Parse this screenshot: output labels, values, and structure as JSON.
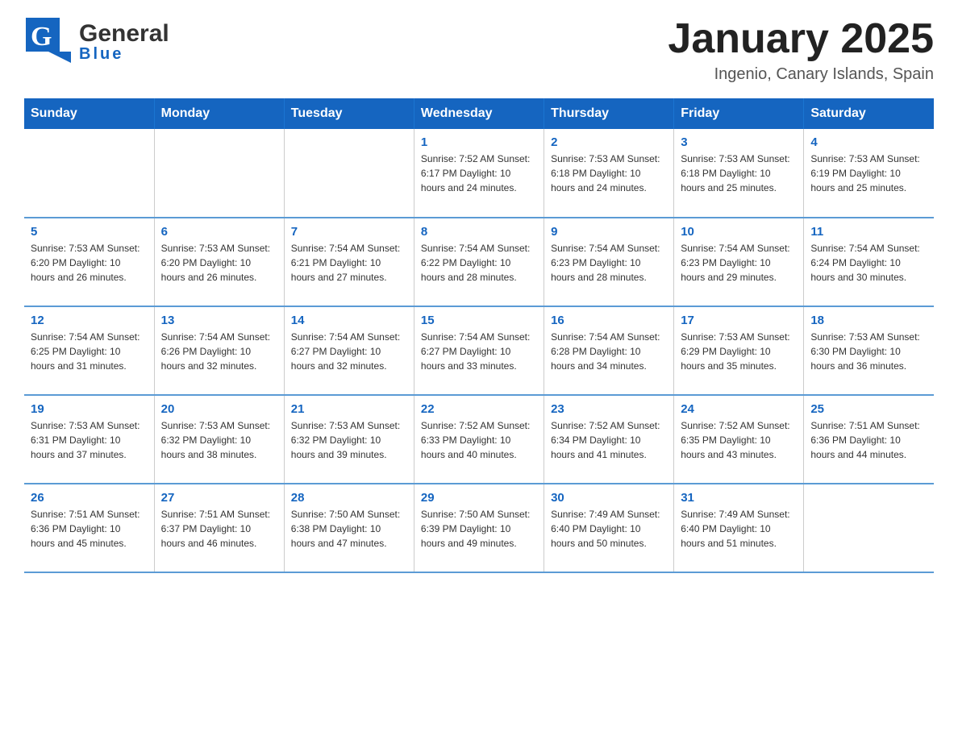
{
  "header": {
    "title": "January 2025",
    "subtitle": "Ingenio, Canary Islands, Spain",
    "logo_general": "General",
    "logo_blue": "Blue"
  },
  "columns": [
    "Sunday",
    "Monday",
    "Tuesday",
    "Wednesday",
    "Thursday",
    "Friday",
    "Saturday"
  ],
  "weeks": [
    [
      {
        "day": "",
        "info": ""
      },
      {
        "day": "",
        "info": ""
      },
      {
        "day": "",
        "info": ""
      },
      {
        "day": "1",
        "info": "Sunrise: 7:52 AM\nSunset: 6:17 PM\nDaylight: 10 hours\nand 24 minutes."
      },
      {
        "day": "2",
        "info": "Sunrise: 7:53 AM\nSunset: 6:18 PM\nDaylight: 10 hours\nand 24 minutes."
      },
      {
        "day": "3",
        "info": "Sunrise: 7:53 AM\nSunset: 6:18 PM\nDaylight: 10 hours\nand 25 minutes."
      },
      {
        "day": "4",
        "info": "Sunrise: 7:53 AM\nSunset: 6:19 PM\nDaylight: 10 hours\nand 25 minutes."
      }
    ],
    [
      {
        "day": "5",
        "info": "Sunrise: 7:53 AM\nSunset: 6:20 PM\nDaylight: 10 hours\nand 26 minutes."
      },
      {
        "day": "6",
        "info": "Sunrise: 7:53 AM\nSunset: 6:20 PM\nDaylight: 10 hours\nand 26 minutes."
      },
      {
        "day": "7",
        "info": "Sunrise: 7:54 AM\nSunset: 6:21 PM\nDaylight: 10 hours\nand 27 minutes."
      },
      {
        "day": "8",
        "info": "Sunrise: 7:54 AM\nSunset: 6:22 PM\nDaylight: 10 hours\nand 28 minutes."
      },
      {
        "day": "9",
        "info": "Sunrise: 7:54 AM\nSunset: 6:23 PM\nDaylight: 10 hours\nand 28 minutes."
      },
      {
        "day": "10",
        "info": "Sunrise: 7:54 AM\nSunset: 6:23 PM\nDaylight: 10 hours\nand 29 minutes."
      },
      {
        "day": "11",
        "info": "Sunrise: 7:54 AM\nSunset: 6:24 PM\nDaylight: 10 hours\nand 30 minutes."
      }
    ],
    [
      {
        "day": "12",
        "info": "Sunrise: 7:54 AM\nSunset: 6:25 PM\nDaylight: 10 hours\nand 31 minutes."
      },
      {
        "day": "13",
        "info": "Sunrise: 7:54 AM\nSunset: 6:26 PM\nDaylight: 10 hours\nand 32 minutes."
      },
      {
        "day": "14",
        "info": "Sunrise: 7:54 AM\nSunset: 6:27 PM\nDaylight: 10 hours\nand 32 minutes."
      },
      {
        "day": "15",
        "info": "Sunrise: 7:54 AM\nSunset: 6:27 PM\nDaylight: 10 hours\nand 33 minutes."
      },
      {
        "day": "16",
        "info": "Sunrise: 7:54 AM\nSunset: 6:28 PM\nDaylight: 10 hours\nand 34 minutes."
      },
      {
        "day": "17",
        "info": "Sunrise: 7:53 AM\nSunset: 6:29 PM\nDaylight: 10 hours\nand 35 minutes."
      },
      {
        "day": "18",
        "info": "Sunrise: 7:53 AM\nSunset: 6:30 PM\nDaylight: 10 hours\nand 36 minutes."
      }
    ],
    [
      {
        "day": "19",
        "info": "Sunrise: 7:53 AM\nSunset: 6:31 PM\nDaylight: 10 hours\nand 37 minutes."
      },
      {
        "day": "20",
        "info": "Sunrise: 7:53 AM\nSunset: 6:32 PM\nDaylight: 10 hours\nand 38 minutes."
      },
      {
        "day": "21",
        "info": "Sunrise: 7:53 AM\nSunset: 6:32 PM\nDaylight: 10 hours\nand 39 minutes."
      },
      {
        "day": "22",
        "info": "Sunrise: 7:52 AM\nSunset: 6:33 PM\nDaylight: 10 hours\nand 40 minutes."
      },
      {
        "day": "23",
        "info": "Sunrise: 7:52 AM\nSunset: 6:34 PM\nDaylight: 10 hours\nand 41 minutes."
      },
      {
        "day": "24",
        "info": "Sunrise: 7:52 AM\nSunset: 6:35 PM\nDaylight: 10 hours\nand 43 minutes."
      },
      {
        "day": "25",
        "info": "Sunrise: 7:51 AM\nSunset: 6:36 PM\nDaylight: 10 hours\nand 44 minutes."
      }
    ],
    [
      {
        "day": "26",
        "info": "Sunrise: 7:51 AM\nSunset: 6:36 PM\nDaylight: 10 hours\nand 45 minutes."
      },
      {
        "day": "27",
        "info": "Sunrise: 7:51 AM\nSunset: 6:37 PM\nDaylight: 10 hours\nand 46 minutes."
      },
      {
        "day": "28",
        "info": "Sunrise: 7:50 AM\nSunset: 6:38 PM\nDaylight: 10 hours\nand 47 minutes."
      },
      {
        "day": "29",
        "info": "Sunrise: 7:50 AM\nSunset: 6:39 PM\nDaylight: 10 hours\nand 49 minutes."
      },
      {
        "day": "30",
        "info": "Sunrise: 7:49 AM\nSunset: 6:40 PM\nDaylight: 10 hours\nand 50 minutes."
      },
      {
        "day": "31",
        "info": "Sunrise: 7:49 AM\nSunset: 6:40 PM\nDaylight: 10 hours\nand 51 minutes."
      },
      {
        "day": "",
        "info": ""
      }
    ]
  ]
}
